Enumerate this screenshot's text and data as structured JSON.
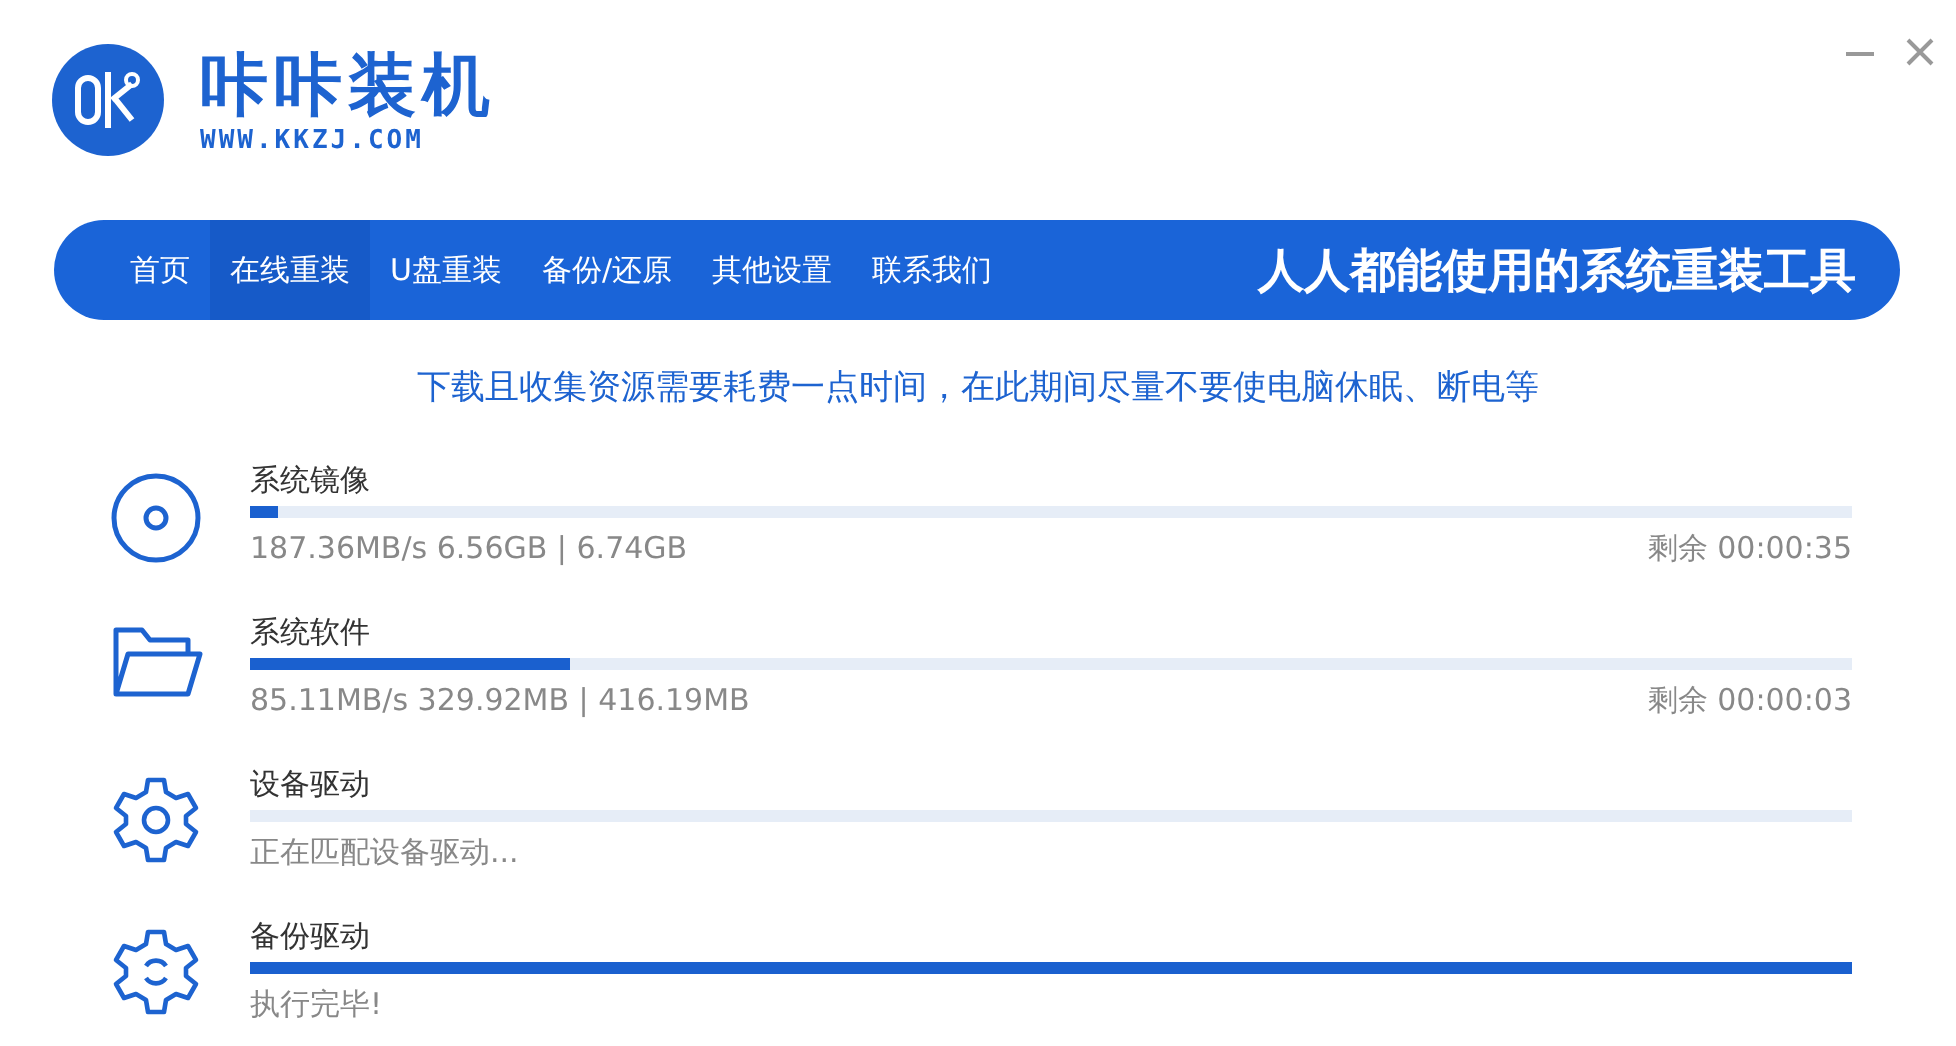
{
  "app": {
    "name": "咔咔装机",
    "url": "WWW.KKZJ.COM"
  },
  "nav": {
    "items": [
      {
        "label": "首页",
        "selected": false
      },
      {
        "label": "在线重装",
        "selected": true
      },
      {
        "label": "U盘重装",
        "selected": false
      },
      {
        "label": "备份/还原",
        "selected": false
      },
      {
        "label": "其他设置",
        "selected": false
      },
      {
        "label": "联系我们",
        "selected": false
      }
    ],
    "slogan": "人人都能使用的系统重装工具"
  },
  "notice": "下载且收集资源需要耗费一点时间，在此期间尽量不要使电脑休眠、断电等",
  "tasks": [
    {
      "kind": "disc",
      "title": "系统镜像",
      "level": 0.018,
      "detail": "187.36MB/s 6.56GB | 6.74GB",
      "remaining": "剩余 00:00:35"
    },
    {
      "kind": "folder",
      "title": "系统软件",
      "level": 0.2,
      "detail": "85.11MB/s 329.92MB | 416.19MB",
      "remaining": "剩余 00:00:03"
    },
    {
      "kind": "gear",
      "title": "设备驱动",
      "level": 0,
      "detail": "正在匹配设备驱动..."
    },
    {
      "kind": "gear-sync",
      "title": "备份驱动",
      "level": 1,
      "detail": "执行完毕!"
    }
  ]
}
